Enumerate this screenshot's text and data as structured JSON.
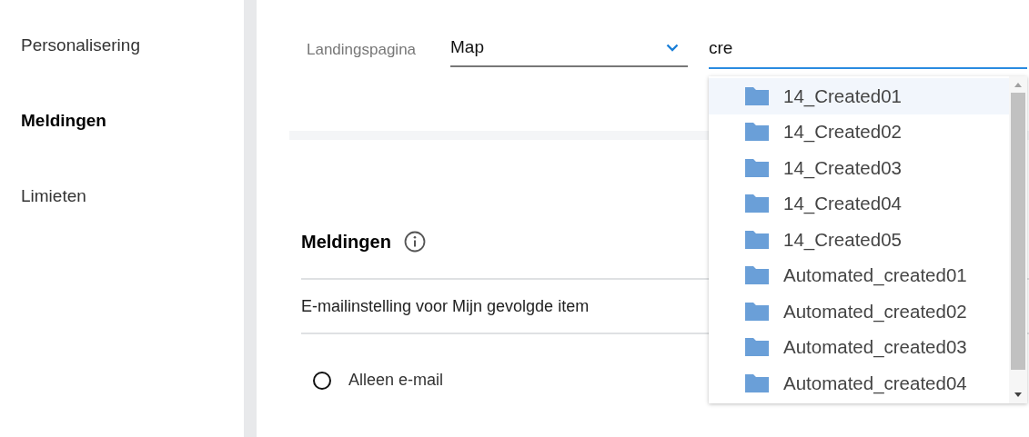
{
  "sidebar": {
    "items": [
      {
        "label": "Personalisering",
        "selected": false
      },
      {
        "label": "Meldingen",
        "selected": true
      },
      {
        "label": "Limieten",
        "selected": false
      }
    ]
  },
  "landing": {
    "label": "Landingspagina",
    "value": "Map"
  },
  "search": {
    "value": "cre"
  },
  "suggestions": [
    {
      "label": "14_Created01",
      "selected": true
    },
    {
      "label": "14_Created02",
      "selected": false
    },
    {
      "label": "14_Created03",
      "selected": false
    },
    {
      "label": "14_Created04",
      "selected": false
    },
    {
      "label": "14_Created05",
      "selected": false
    },
    {
      "label": "Automated_created01",
      "selected": false
    },
    {
      "label": "Automated_created02",
      "selected": false
    },
    {
      "label": "Automated_created03",
      "selected": false
    },
    {
      "label": "Automated_created04",
      "selected": false
    }
  ],
  "notifications": {
    "title": "Meldingen",
    "setting_label": "E-mailinstelling voor Mijn gevolgde item",
    "options": [
      {
        "label": "Alleen e-mail",
        "selected": false
      }
    ]
  }
}
